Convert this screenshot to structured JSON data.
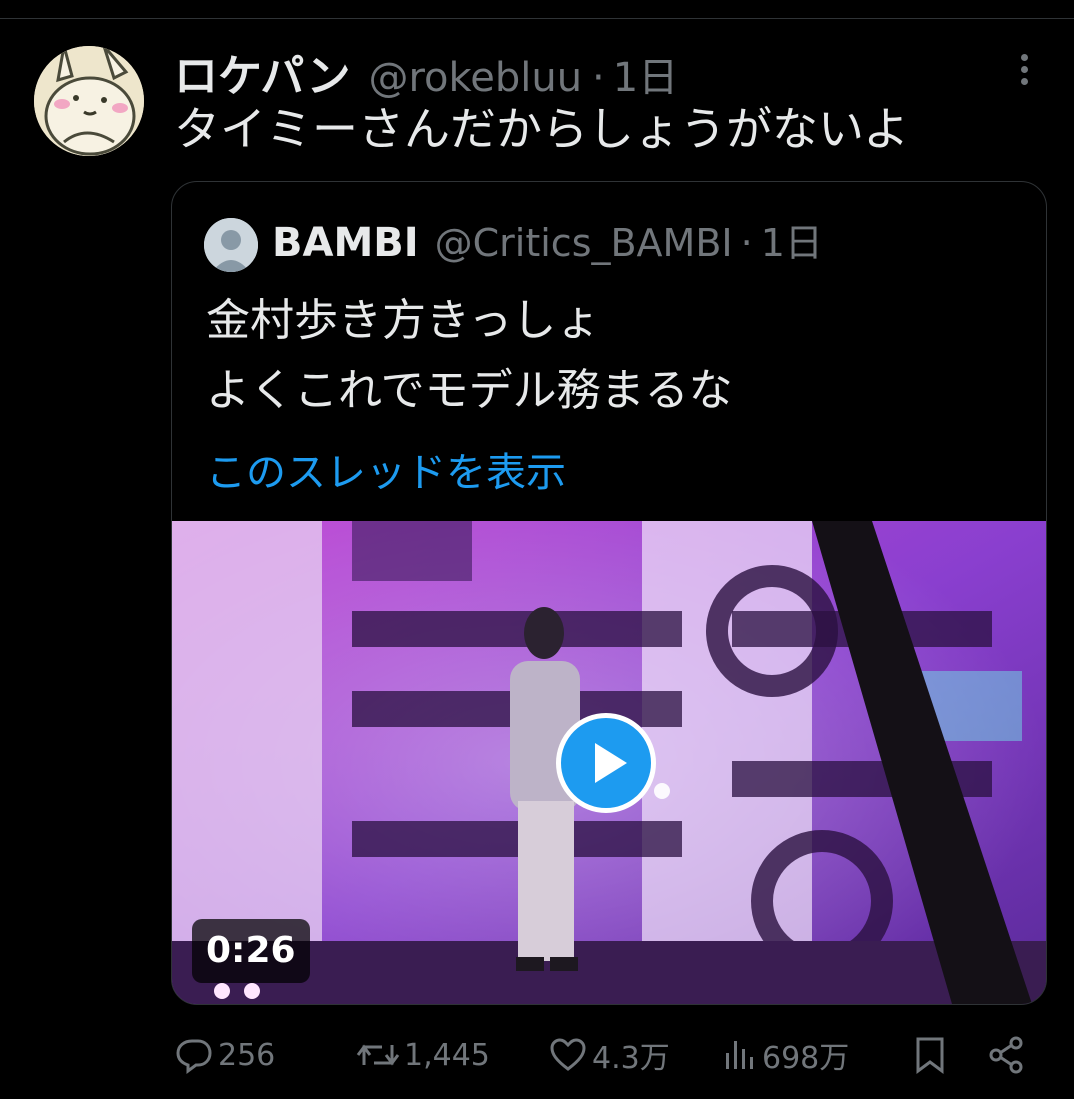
{
  "tweet": {
    "author_name": "ロケパン",
    "author_handle": "@rokebluu",
    "time": "1日",
    "text": "タイミーさんだからしょうがないよ"
  },
  "quoted_tweet": {
    "author_name": "BAMBI",
    "author_handle": "@Critics_BAMBI",
    "time": "1日",
    "text_lines": [
      "金村歩き方きっしょ",
      "よくこれでモデル務まるな"
    ],
    "thread_link": "このスレッドを表示",
    "video": {
      "duration": "0:26"
    }
  },
  "actions": {
    "replies": "256",
    "reposts": "1,445",
    "likes": "4.3万",
    "views": "698万"
  },
  "colors": {
    "accent": "#1d9bf0",
    "muted": "#71767b",
    "text": "#e7e9ea",
    "background": "#000000"
  }
}
